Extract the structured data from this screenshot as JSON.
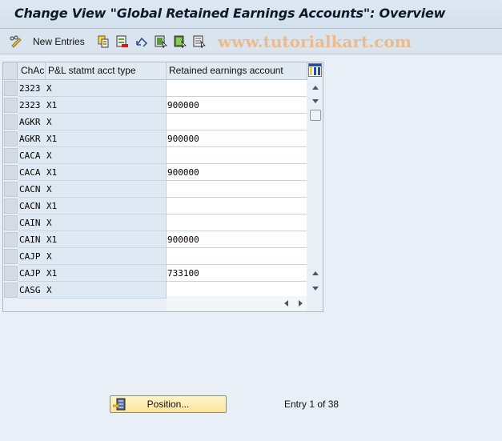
{
  "window": {
    "title": "Change View \"Global Retained Earnings Accounts\": Overview"
  },
  "toolbar": {
    "items": [
      {
        "icon": "pencil-glasses-icon",
        "label": ""
      },
      {
        "icon": "new-entries-label",
        "label": "New Entries"
      },
      {
        "icon": "copy-as-icon",
        "label": ""
      },
      {
        "icon": "delete-icon",
        "label": ""
      },
      {
        "icon": "undo-change-icon",
        "label": ""
      },
      {
        "icon": "select-all-icon",
        "label": ""
      },
      {
        "icon": "select-block-icon",
        "label": ""
      },
      {
        "icon": "deselect-all-icon",
        "label": ""
      }
    ],
    "watermark": "www.tutorialkart.com"
  },
  "table": {
    "columns": [
      "ChAc",
      "P&L statmt acct type",
      "Retained earnings account"
    ],
    "rows": [
      {
        "chac": "2323",
        "type": "X",
        "account": ""
      },
      {
        "chac": "2323",
        "type": "X1",
        "account": "900000"
      },
      {
        "chac": "AGKR",
        "type": "X",
        "account": ""
      },
      {
        "chac": "AGKR",
        "type": "X1",
        "account": "900000"
      },
      {
        "chac": "CACA",
        "type": "X",
        "account": ""
      },
      {
        "chac": "CACA",
        "type": "X1",
        "account": "900000"
      },
      {
        "chac": "CACN",
        "type": "X",
        "account": ""
      },
      {
        "chac": "CACN",
        "type": "X1",
        "account": ""
      },
      {
        "chac": "CAIN",
        "type": "X",
        "account": ""
      },
      {
        "chac": "CAIN",
        "type": "X1",
        "account": "900000"
      },
      {
        "chac": "CAJP",
        "type": "X",
        "account": ""
      },
      {
        "chac": "CAJP",
        "type": "X1",
        "account": "733100"
      },
      {
        "chac": "CASG",
        "type": "X",
        "account": ""
      }
    ]
  },
  "footer": {
    "position_button": "Position...",
    "entry_info": "Entry 1 of 38"
  },
  "colors": {
    "button_fill": "#fbe49a",
    "key_cell_bg": "#dfe9f3",
    "background": "#e9eff6"
  }
}
